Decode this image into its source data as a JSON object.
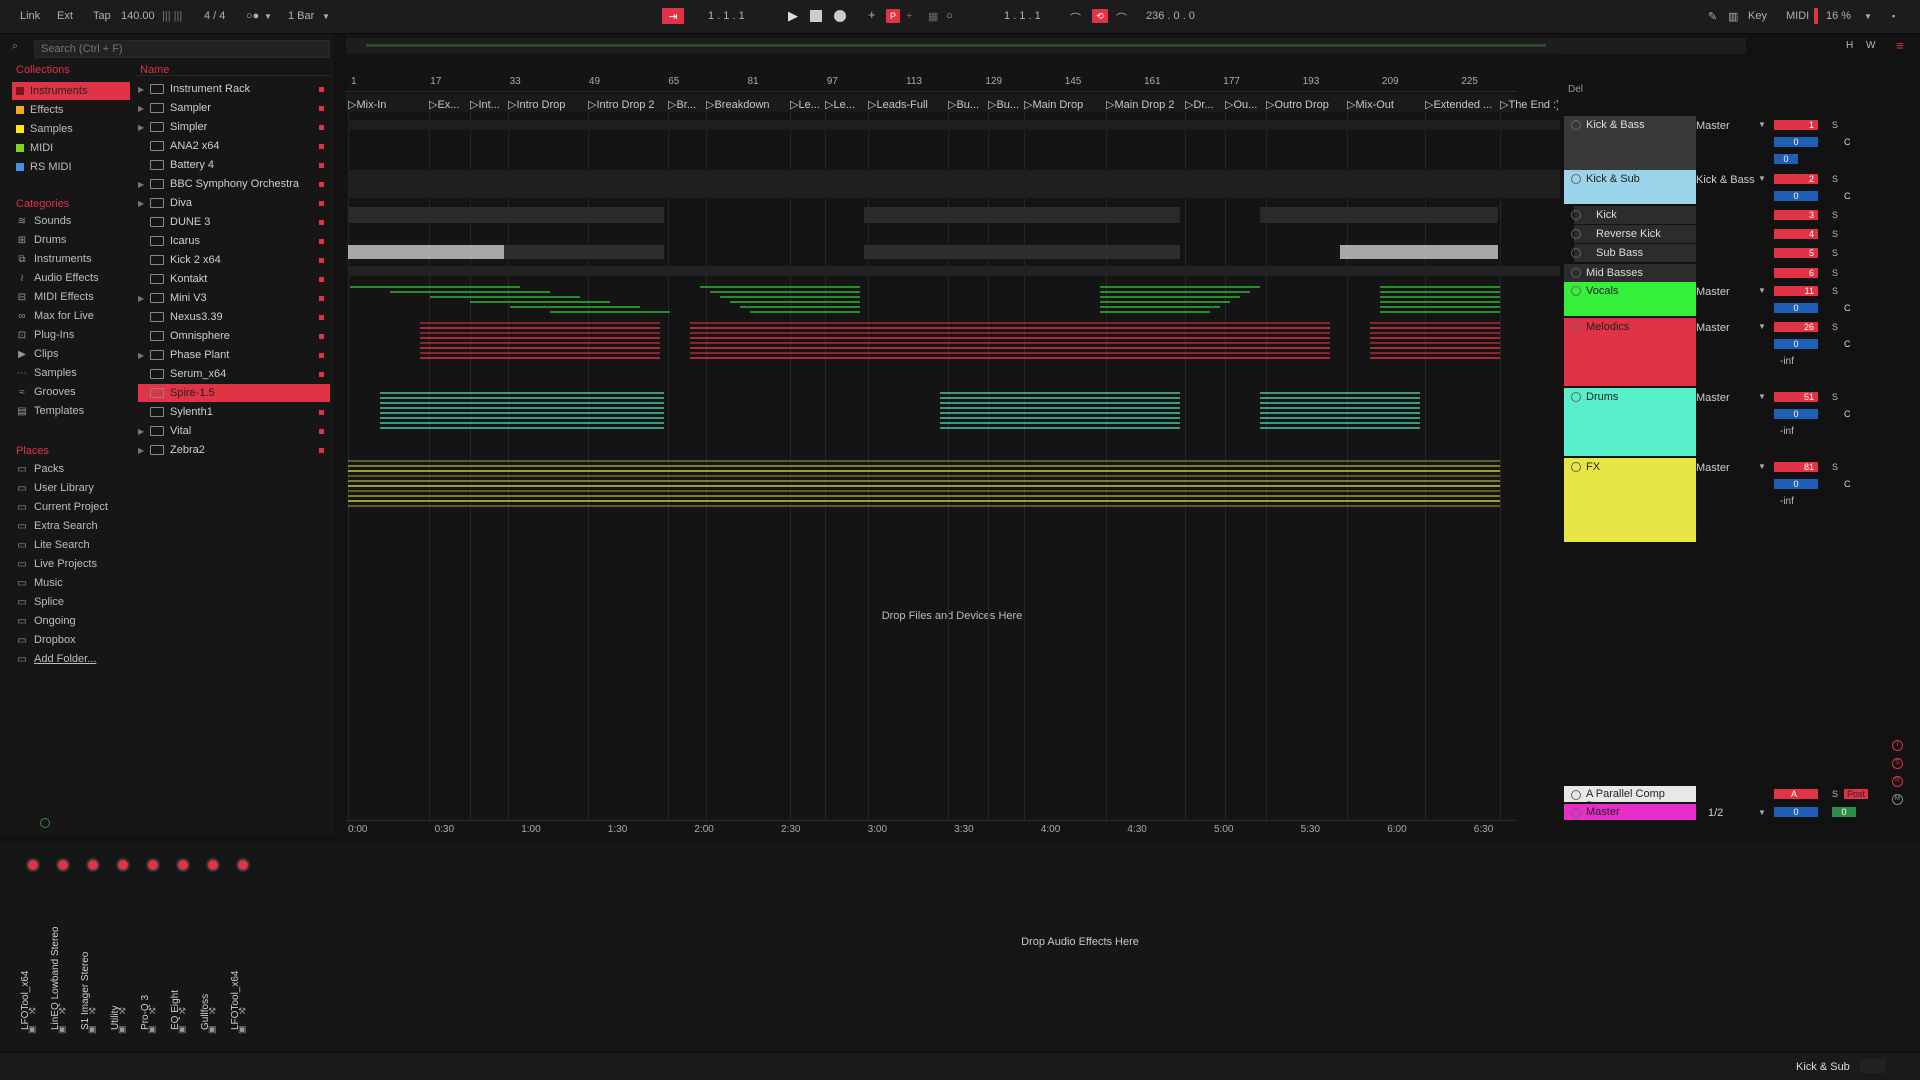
{
  "topbar": {
    "link": "Link",
    "ext": "Ext",
    "tap": "Tap",
    "bpm": "140.00",
    "sig": "4 / 4",
    "quant": "1 Bar",
    "pos": "1 .   1 .   1",
    "loop_start": "1 .   1 .   1",
    "loop_len": "236 .   0 .   0",
    "key": "Key",
    "midi": "MIDI",
    "cpu": "16 %",
    "h": "H",
    "w": "W"
  },
  "browser": {
    "search_placeholder": "Search (Ctrl + F)",
    "collections_header": "Collections",
    "categories_header": "Categories",
    "places_header": "Places",
    "name_header": "Name",
    "collections": [
      {
        "label": "Instruments",
        "color": "#e03345",
        "selected": true
      },
      {
        "label": "Effects",
        "color": "#f5a623"
      },
      {
        "label": "Samples",
        "color": "#f8e71c"
      },
      {
        "label": "MIDI",
        "color": "#7ed321"
      },
      {
        "label": "RS MIDI",
        "color": "#4a90e2"
      }
    ],
    "categories": [
      "Sounds",
      "Drums",
      "Instruments",
      "Audio Effects",
      "MIDI Effects",
      "Max for Live",
      "Plug-Ins",
      "Clips",
      "Samples",
      "Grooves",
      "Templates"
    ],
    "places": [
      "Packs",
      "User Library",
      "Current Project",
      "Extra Search",
      "Lite Search",
      "Live Projects",
      "Music",
      "Splice",
      "Ongoing",
      "Dropbox",
      "Add Folder..."
    ],
    "files": [
      {
        "label": "Instrument Rack",
        "exp": true
      },
      {
        "label": "Sampler",
        "exp": true
      },
      {
        "label": "Simpler",
        "exp": true
      },
      {
        "label": "ANA2 x64"
      },
      {
        "label": "Battery 4"
      },
      {
        "label": "BBC Symphony Orchestra",
        "exp": true
      },
      {
        "label": "Diva",
        "exp": true
      },
      {
        "label": "DUNE 3"
      },
      {
        "label": "Icarus"
      },
      {
        "label": "Kick 2 x64"
      },
      {
        "label": "Kontakt"
      },
      {
        "label": "Mini V3",
        "exp": true
      },
      {
        "label": "Nexus3.39"
      },
      {
        "label": "Omnisphere"
      },
      {
        "label": "Phase Plant",
        "exp": true
      },
      {
        "label": "Serum_x64"
      },
      {
        "label": "Spire-1.5",
        "selected": true
      },
      {
        "label": "Sylenth1"
      },
      {
        "label": "Vital",
        "exp": true
      },
      {
        "label": "Zebra2",
        "exp": true
      }
    ]
  },
  "arrangement": {
    "ruler": [
      "1",
      "17",
      "33",
      "49",
      "65",
      "81",
      "97",
      "113",
      "129",
      "145",
      "161",
      "177",
      "193",
      "209",
      "225"
    ],
    "markers": [
      "Mix-In",
      "Ex...",
      "Int...",
      "Intro Drop",
      "Intro Drop 2",
      "Br...",
      "Breakdown",
      "Le...",
      "Le...",
      "Leads-Full",
      "Bu...",
      "Bu...",
      "Main Drop",
      "Main Drop 2",
      "Dr...",
      "Ou...",
      "Outro Drop",
      "Mix-Out",
      "Extended ...",
      "The End :)"
    ],
    "times": [
      "0:00",
      "0:30",
      "1:00",
      "1:30",
      "2:00",
      "2:30",
      "3:00",
      "3:30",
      "4:00",
      "4:30",
      "5:00",
      "5:30",
      "6:00",
      "6:30"
    ],
    "drop_text": "Drop Files and Devices Here",
    "del_label": "Del"
  },
  "mixer": {
    "tracks": [
      {
        "name": "Kick & Bass",
        "route": "Master",
        "num": "1",
        "vol": "0",
        "vol2": "0",
        "color": "#3a3a3a"
      },
      {
        "name": "Kick & Sub",
        "route": "Kick & Bass",
        "num": "2",
        "vol": "0",
        "color": "#9ad4ea"
      },
      {
        "name": "Kick",
        "num": "3",
        "color": "#2c2c2c"
      },
      {
        "name": "Reverse Kick",
        "num": "4",
        "color": "#2c2c2c"
      },
      {
        "name": "Sub Bass",
        "num": "5",
        "color": "#2c2c2c"
      },
      {
        "name": "Mid Basses",
        "num": "6",
        "color": "#2c2c2c"
      },
      {
        "name": "Vocals",
        "route": "Master",
        "num": "11",
        "vol": "0",
        "color": "#35f03a"
      },
      {
        "name": "Melodics",
        "route": "Master",
        "num": "26",
        "vol": "0",
        "inf": "-inf",
        "color": "#e03345"
      },
      {
        "name": "Drums",
        "route": "Master",
        "num": "51",
        "vol": "0",
        "inf": "-inf",
        "color": "#58f0cc"
      },
      {
        "name": "FX",
        "route": "Master",
        "num": "81",
        "vol": "0",
        "inf": "-inf",
        "color": "#e6e645"
      }
    ],
    "return": {
      "name": "A Parallel Comp Bus",
      "num": "A",
      "post": "Post"
    },
    "master": {
      "name": "Master",
      "route": "1/2",
      "vol": "0",
      "vol2": "0"
    },
    "s_label": "S",
    "c_label": "C"
  },
  "devices": {
    "list": [
      "LFOTool_x64",
      "LinEQ Lowband Stereo",
      "S1 Imager Stereo",
      "Utility",
      "Pro-Q 3",
      "EQ Eight",
      "Gullfoss",
      "LFOTool_x64"
    ],
    "drop_text": "Drop Audio Effects Here"
  },
  "status": {
    "selected_track": "Kick & Sub"
  }
}
